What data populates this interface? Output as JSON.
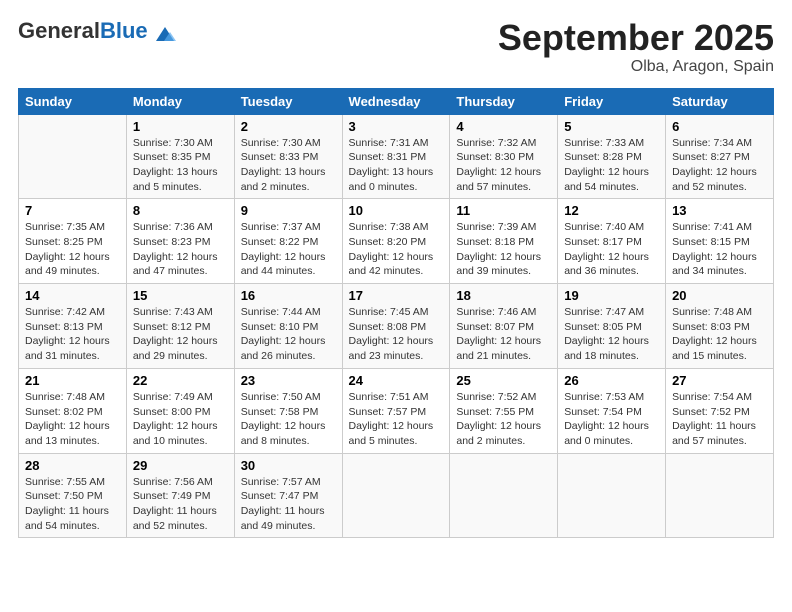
{
  "header": {
    "logo_general": "General",
    "logo_blue": "Blue",
    "month_title": "September 2025",
    "location": "Olba, Aragon, Spain"
  },
  "days_of_week": [
    "Sunday",
    "Monday",
    "Tuesday",
    "Wednesday",
    "Thursday",
    "Friday",
    "Saturday"
  ],
  "weeks": [
    [
      {
        "day": "",
        "info": ""
      },
      {
        "day": "1",
        "info": "Sunrise: 7:30 AM\nSunset: 8:35 PM\nDaylight: 13 hours\nand 5 minutes."
      },
      {
        "day": "2",
        "info": "Sunrise: 7:30 AM\nSunset: 8:33 PM\nDaylight: 13 hours\nand 2 minutes."
      },
      {
        "day": "3",
        "info": "Sunrise: 7:31 AM\nSunset: 8:31 PM\nDaylight: 13 hours\nand 0 minutes."
      },
      {
        "day": "4",
        "info": "Sunrise: 7:32 AM\nSunset: 8:30 PM\nDaylight: 12 hours\nand 57 minutes."
      },
      {
        "day": "5",
        "info": "Sunrise: 7:33 AM\nSunset: 8:28 PM\nDaylight: 12 hours\nand 54 minutes."
      },
      {
        "day": "6",
        "info": "Sunrise: 7:34 AM\nSunset: 8:27 PM\nDaylight: 12 hours\nand 52 minutes."
      }
    ],
    [
      {
        "day": "7",
        "info": "Sunrise: 7:35 AM\nSunset: 8:25 PM\nDaylight: 12 hours\nand 49 minutes."
      },
      {
        "day": "8",
        "info": "Sunrise: 7:36 AM\nSunset: 8:23 PM\nDaylight: 12 hours\nand 47 minutes."
      },
      {
        "day": "9",
        "info": "Sunrise: 7:37 AM\nSunset: 8:22 PM\nDaylight: 12 hours\nand 44 minutes."
      },
      {
        "day": "10",
        "info": "Sunrise: 7:38 AM\nSunset: 8:20 PM\nDaylight: 12 hours\nand 42 minutes."
      },
      {
        "day": "11",
        "info": "Sunrise: 7:39 AM\nSunset: 8:18 PM\nDaylight: 12 hours\nand 39 minutes."
      },
      {
        "day": "12",
        "info": "Sunrise: 7:40 AM\nSunset: 8:17 PM\nDaylight: 12 hours\nand 36 minutes."
      },
      {
        "day": "13",
        "info": "Sunrise: 7:41 AM\nSunset: 8:15 PM\nDaylight: 12 hours\nand 34 minutes."
      }
    ],
    [
      {
        "day": "14",
        "info": "Sunrise: 7:42 AM\nSunset: 8:13 PM\nDaylight: 12 hours\nand 31 minutes."
      },
      {
        "day": "15",
        "info": "Sunrise: 7:43 AM\nSunset: 8:12 PM\nDaylight: 12 hours\nand 29 minutes."
      },
      {
        "day": "16",
        "info": "Sunrise: 7:44 AM\nSunset: 8:10 PM\nDaylight: 12 hours\nand 26 minutes."
      },
      {
        "day": "17",
        "info": "Sunrise: 7:45 AM\nSunset: 8:08 PM\nDaylight: 12 hours\nand 23 minutes."
      },
      {
        "day": "18",
        "info": "Sunrise: 7:46 AM\nSunset: 8:07 PM\nDaylight: 12 hours\nand 21 minutes."
      },
      {
        "day": "19",
        "info": "Sunrise: 7:47 AM\nSunset: 8:05 PM\nDaylight: 12 hours\nand 18 minutes."
      },
      {
        "day": "20",
        "info": "Sunrise: 7:48 AM\nSunset: 8:03 PM\nDaylight: 12 hours\nand 15 minutes."
      }
    ],
    [
      {
        "day": "21",
        "info": "Sunrise: 7:48 AM\nSunset: 8:02 PM\nDaylight: 12 hours\nand 13 minutes."
      },
      {
        "day": "22",
        "info": "Sunrise: 7:49 AM\nSunset: 8:00 PM\nDaylight: 12 hours\nand 10 minutes."
      },
      {
        "day": "23",
        "info": "Sunrise: 7:50 AM\nSunset: 7:58 PM\nDaylight: 12 hours\nand 8 minutes."
      },
      {
        "day": "24",
        "info": "Sunrise: 7:51 AM\nSunset: 7:57 PM\nDaylight: 12 hours\nand 5 minutes."
      },
      {
        "day": "25",
        "info": "Sunrise: 7:52 AM\nSunset: 7:55 PM\nDaylight: 12 hours\nand 2 minutes."
      },
      {
        "day": "26",
        "info": "Sunrise: 7:53 AM\nSunset: 7:54 PM\nDaylight: 12 hours\nand 0 minutes."
      },
      {
        "day": "27",
        "info": "Sunrise: 7:54 AM\nSunset: 7:52 PM\nDaylight: 11 hours\nand 57 minutes."
      }
    ],
    [
      {
        "day": "28",
        "info": "Sunrise: 7:55 AM\nSunset: 7:50 PM\nDaylight: 11 hours\nand 54 minutes."
      },
      {
        "day": "29",
        "info": "Sunrise: 7:56 AM\nSunset: 7:49 PM\nDaylight: 11 hours\nand 52 minutes."
      },
      {
        "day": "30",
        "info": "Sunrise: 7:57 AM\nSunset: 7:47 PM\nDaylight: 11 hours\nand 49 minutes."
      },
      {
        "day": "",
        "info": ""
      },
      {
        "day": "",
        "info": ""
      },
      {
        "day": "",
        "info": ""
      },
      {
        "day": "",
        "info": ""
      }
    ]
  ]
}
